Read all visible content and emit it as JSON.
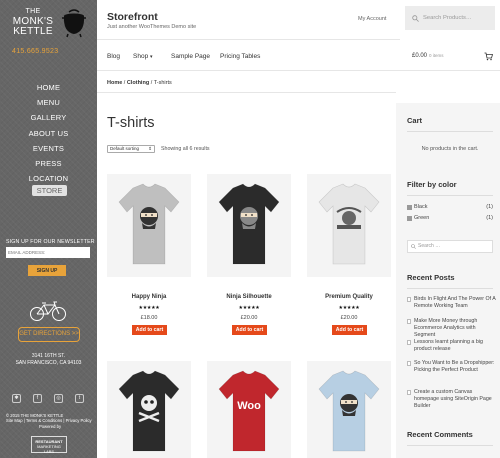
{
  "sidebar": {
    "logo": {
      "line1": "THE",
      "line2": "MONK'S",
      "line3": "KETTLE"
    },
    "phone": "415.665.9523",
    "nav": [
      "HOME",
      "MENU",
      "GALLERY",
      "ABOUT US",
      "EVENTS",
      "PRESS",
      "LOCATION"
    ],
    "nav_active": "STORE",
    "newsletter": {
      "title": "SIGN UP FOR OUR NEWSLETTER",
      "placeholder": "EMAIL ADDRESS:",
      "button": "SIGN UP"
    },
    "directions": "GET DIRECTIONS >>",
    "address": [
      "3141 16TH ST.",
      "SAN FRANCISCO, CA 94103"
    ],
    "socials": [
      "yelp-icon",
      "facebook-icon",
      "instagram-icon",
      "twitter-icon"
    ],
    "footer": {
      "copyright": "© 2015 THE MONK'S KETTLE",
      "links": "Site Map | Terms & Conditions | Privacy Policy",
      "powered": "Powered by",
      "brand_line1": "RESTAURANT",
      "brand_line2": "MARKETING LABS"
    }
  },
  "header": {
    "site_title": "Storefront",
    "site_desc": "Just another WooThemes Demo site",
    "my_account": "My Account",
    "search_placeholder": "Search Products…",
    "nav": [
      "Blog",
      "Shop",
      "Sample Page",
      "Pricing Tables"
    ],
    "shop_chevron": "▾",
    "cart_total": "£0.00",
    "cart_items": "0 items"
  },
  "breadcrumb": {
    "home": "Home",
    "cat": "Clothing",
    "current": "T-shirts",
    "sep": " / "
  },
  "page_title": "T-shirts",
  "sorting": {
    "selected": "Default sorting",
    "result_count": "Showing all 6 results"
  },
  "products": [
    {
      "name": "Happy Ninja",
      "price": "£18.00",
      "stars": "★★★★★",
      "button": "Add to cart",
      "shirt_color": "#bfbfbf",
      "graphic": "ninja"
    },
    {
      "name": "Ninja Silhouette",
      "price": "£20.00",
      "stars": "★★★★★",
      "button": "Add to cart",
      "shirt_color": "#2b2b2b",
      "graphic": "ninja-outline"
    },
    {
      "name": "Premium Quality",
      "price": "£20.00",
      "stars": "★★★★★",
      "button": "Add to cart",
      "shirt_color": "#e6e6e6",
      "graphic": "woo-badge"
    },
    {
      "name": "",
      "price": "",
      "stars": "",
      "button": "",
      "shirt_color": "#2b2b2b",
      "graphic": "skull"
    },
    {
      "name": "",
      "price": "",
      "stars": "",
      "button": "",
      "shirt_color": "#c0272d",
      "graphic": "woo"
    },
    {
      "name": "",
      "price": "",
      "stars": "",
      "button": "",
      "shirt_color": "#b7cfe3",
      "graphic": "ninja"
    }
  ],
  "rightbar": {
    "cart_title": "Cart",
    "cart_empty": "No products in the cart.",
    "filter_title": "Filter by color",
    "filters": [
      {
        "label": "Black",
        "count": "(1)"
      },
      {
        "label": "Green",
        "count": "(1)"
      }
    ],
    "search_placeholder": "Search …",
    "recent_title": "Recent Posts",
    "posts": [
      "Birds In Flight And The Power Of A Remote Working Team",
      "Make More Money through Ecommerce Analytics with Segment",
      "Lessons learnt planning a big product release",
      "So You Want to Be a Dropshipper: Picking the Perfect Product",
      "Create a custom Canvas homepage using SiteOrigin Page Builder"
    ],
    "comments_title": "Recent Comments"
  }
}
